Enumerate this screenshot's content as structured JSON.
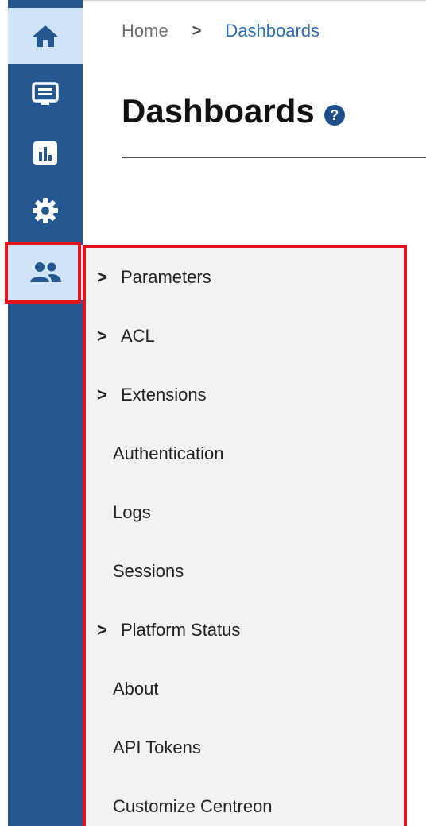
{
  "sidebar": {
    "items": [
      {
        "name": "home",
        "icon": "home-icon"
      },
      {
        "name": "monitoring",
        "icon": "monitor-icon"
      },
      {
        "name": "reporting",
        "icon": "bar-chart-icon"
      },
      {
        "name": "configuration",
        "icon": "gear-icon"
      },
      {
        "name": "administration",
        "icon": "users-icon"
      }
    ]
  },
  "header": {
    "breadcrumb": {
      "home": "Home",
      "separator": ">",
      "current": "Dashboards"
    },
    "title": "Dashboards",
    "help": "?"
  },
  "menu": {
    "items": [
      {
        "label": "Parameters",
        "chevron": ">"
      },
      {
        "label": "ACL",
        "chevron": ">"
      },
      {
        "label": "Extensions",
        "chevron": ">"
      },
      {
        "label": "Authentication"
      },
      {
        "label": "Logs"
      },
      {
        "label": "Sessions"
      },
      {
        "label": "Platform Status",
        "chevron": ">"
      },
      {
        "label": "About"
      },
      {
        "label": "API Tokens"
      },
      {
        "label": "Customize Centreon"
      }
    ]
  },
  "colors": {
    "sidebar": "#255891",
    "sidebar_active": "#cfe4f7",
    "highlight": "#e3151a",
    "menu_bg": "#f3f2f2",
    "breadcrumb_link": "#2f6db1"
  }
}
